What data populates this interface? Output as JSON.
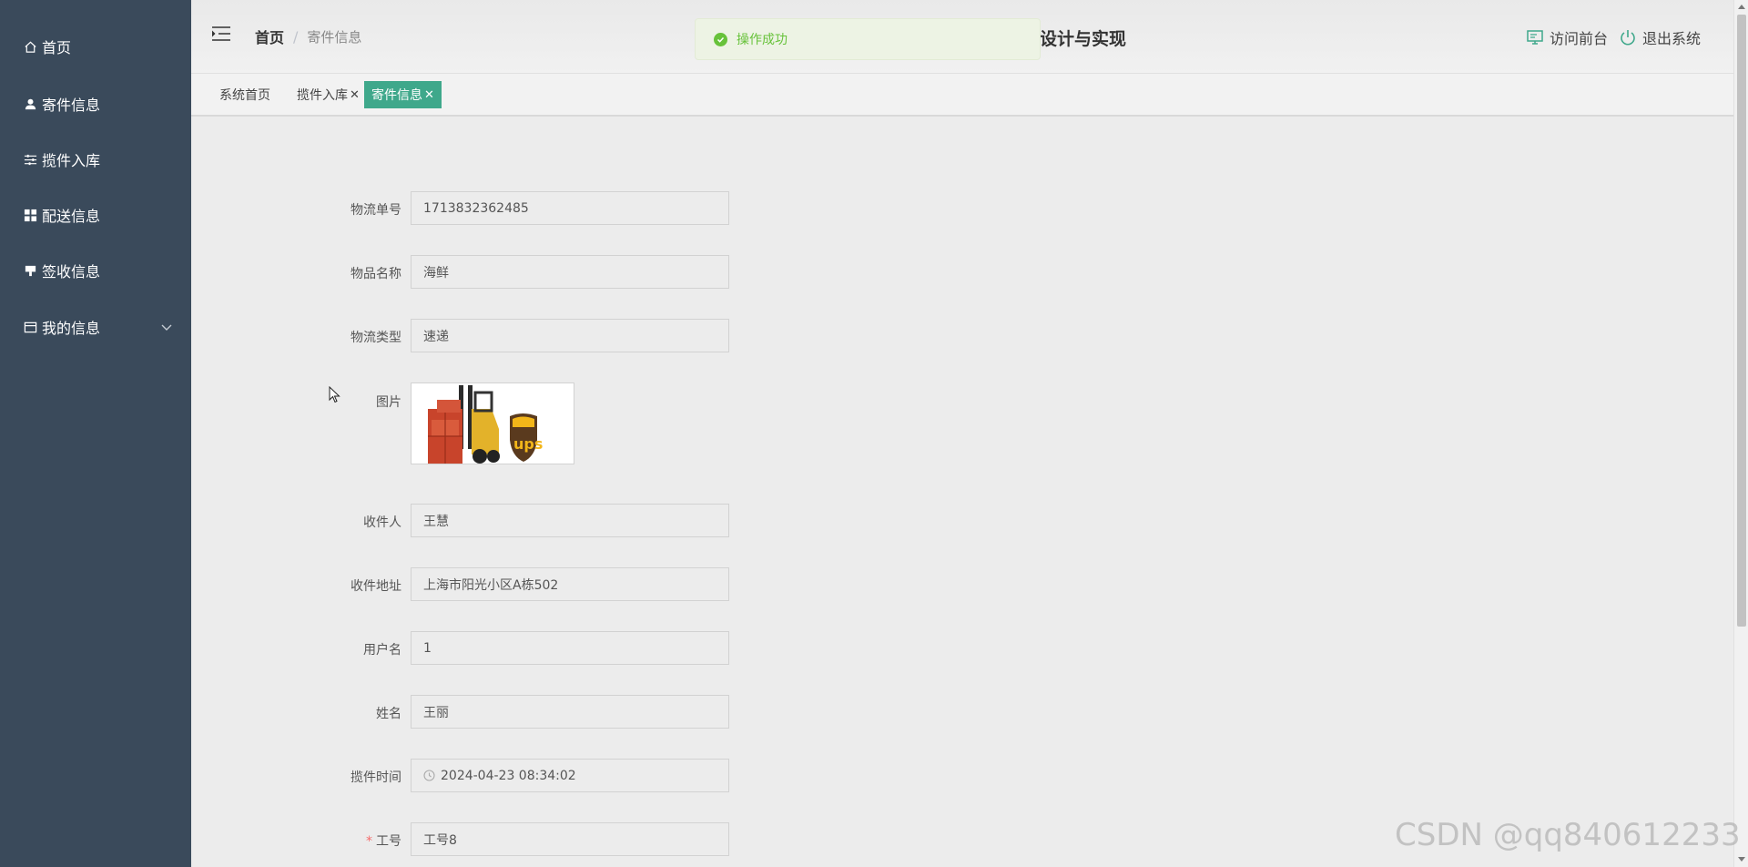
{
  "sidebar": {
    "items": [
      {
        "label": "首页",
        "icon": "home-icon"
      },
      {
        "label": "寄件信息",
        "icon": "user-icon"
      },
      {
        "label": "揽件入库",
        "icon": "sliders-icon"
      },
      {
        "label": "配送信息",
        "icon": "grid-icon"
      },
      {
        "label": "签收信息",
        "icon": "stamp-icon"
      },
      {
        "label": "我的信息",
        "icon": "card-icon"
      }
    ]
  },
  "header": {
    "breadcrumb_home": "首页",
    "breadcrumb_sep": "/",
    "breadcrumb_current": "寄件信息",
    "title": "设计与实现",
    "toast": "操作成功",
    "visit_front": "访问前台",
    "logout": "退出系统"
  },
  "tabs": [
    {
      "label": "系统首页",
      "active": false,
      "closable": false
    },
    {
      "label": "揽件入库",
      "active": false,
      "closable": true
    },
    {
      "label": "寄件信息",
      "active": true,
      "closable": true
    }
  ],
  "form": {
    "tracking_no_label": "物流单号",
    "tracking_no_value": "1713832362485",
    "item_name_label": "物品名称",
    "item_name_value": "海鲜",
    "logistics_type_label": "物流类型",
    "logistics_type_value": "速递",
    "image_label": "图片",
    "recipient_label": "收件人",
    "recipient_value": "王慧",
    "address_label": "收件地址",
    "address_value": "上海市阳光小区A栋502",
    "username_label": "用户名",
    "username_value": "1",
    "name_label": "姓名",
    "name_value": "王丽",
    "pickup_time_label": "揽件时间",
    "pickup_time_value": "2024-04-23 08:34:02",
    "staff_no_label": "工号",
    "staff_no_value": "工号8",
    "required_mark": "*"
  },
  "watermark": "CSDN @qq840612233",
  "colors": {
    "sidebar_bg": "#3a4a5b",
    "accent": "#3fa88b",
    "success": "#67c23a"
  }
}
